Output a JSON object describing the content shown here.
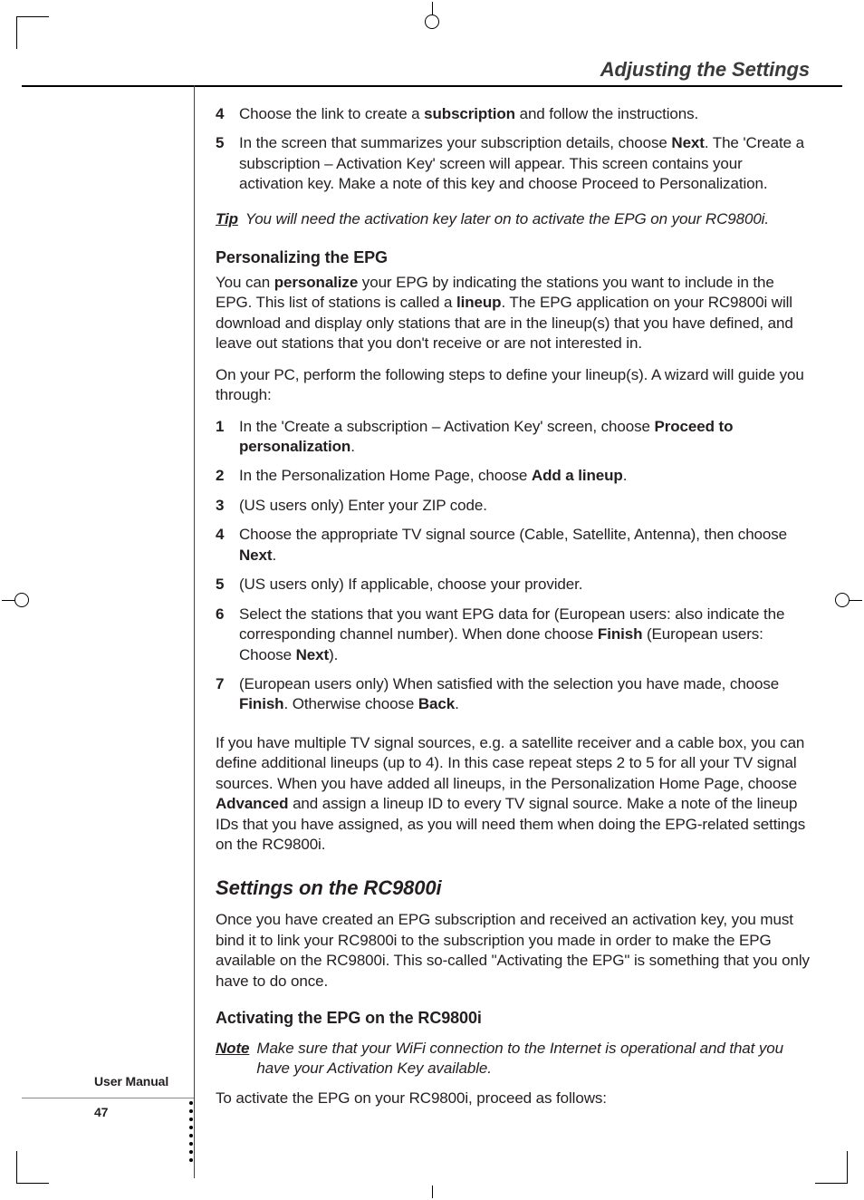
{
  "header": {
    "title": "Adjusting the Settings"
  },
  "stepsA": {
    "s4": {
      "num": "4",
      "pre": "Choose the link to create a ",
      "bold": "subscription",
      "post": " and follow the instructions."
    },
    "s5": {
      "num": "5",
      "line1_pre": "In the screen that summarizes your subscription details, choose ",
      "line1_bold": "Next",
      "line1_post": ".",
      "rest": "The 'Create a subscription – Activation Key' screen will appear. This screen contains your activation key. Make a note of this key and choose Proceed to Personalization."
    }
  },
  "tip": {
    "label": "Tip",
    "text": "You will need the activation key later on to activate the EPG on your RC9800i."
  },
  "personalize": {
    "heading": "Personalizing the EPG",
    "p1_a": "You can ",
    "p1_b": "personalize",
    "p1_c": " your EPG by indicating the stations you want to include in the EPG. This list of stations is called a ",
    "p1_d": "lineup",
    "p1_e": ". The EPG application on your RC9800i will download and display only stations that are in the lineup(s) that you have defined, and leave out stations that you don't receive or are not interested in.",
    "p2": "On your PC, perform the following steps to define your lineup(s). A wizard will guide you through:"
  },
  "stepsB": {
    "s1": {
      "num": "1",
      "pre": "In the 'Create a subscription – Activation Key' screen, choose ",
      "bold": "Proceed to personalization",
      "post": "."
    },
    "s2": {
      "num": "2",
      "pre": "In the Personalization Home Page, choose ",
      "bold": "Add a lineup",
      "post": "."
    },
    "s3": {
      "num": "3",
      "text": "(US users only) Enter your ZIP code."
    },
    "s4": {
      "num": "4",
      "pre": "Choose the appropriate TV signal source (Cable, Satellite, Antenna), then choose ",
      "bold": "Next",
      "post": "."
    },
    "s5": {
      "num": "5",
      "text": "(US users only) If applicable, choose your provider."
    },
    "s6": {
      "num": "6",
      "pre": "Select the stations that you want EPG data for (European users: also indicate the corresponding channel number). When done choose ",
      "bold": "Finish",
      "post_pre": " (European users: Choose ",
      "bold2": "Next",
      "post": ")."
    },
    "s7": {
      "num": "7",
      "pre": "(European users only) When satisfied with the selection you have made, choose ",
      "bold": "Finish",
      "mid": ". Otherwise choose ",
      "bold2": "Back",
      "post": "."
    }
  },
  "multi": {
    "a": "If you have multiple TV signal sources, e.g. a satellite receiver and a cable box, you can define additional lineups (up to 4). In this case repeat steps 2 to 5 for all your TV signal sources. When you have added all lineups, in the Personalization Home Page, choose ",
    "b": "Advanced",
    "c": " and assign a lineup ID to every TV signal source. Make a note of the lineup IDs that you have assigned, as you will need them when doing the EPG-related settings on the RC9800i."
  },
  "settings": {
    "heading": "Settings on the RC9800i",
    "p": "Once you have created an EPG subscription and received an activation key, you must bind it to link your RC9800i to the subscription you made in order to make the EPG available on the RC9800i. This so-called \"Activating the EPG\" is something that you only have to do once."
  },
  "activating": {
    "heading": "Activating the EPG on the RC9800i",
    "note_label": "Note",
    "note_text": "Make sure that your WiFi connection to the Internet is operational and that you have your Activation Key available.",
    "p": "To activate the EPG on your RC9800i, proceed as follows:"
  },
  "footer": {
    "label": "User Manual",
    "page": "47"
  }
}
